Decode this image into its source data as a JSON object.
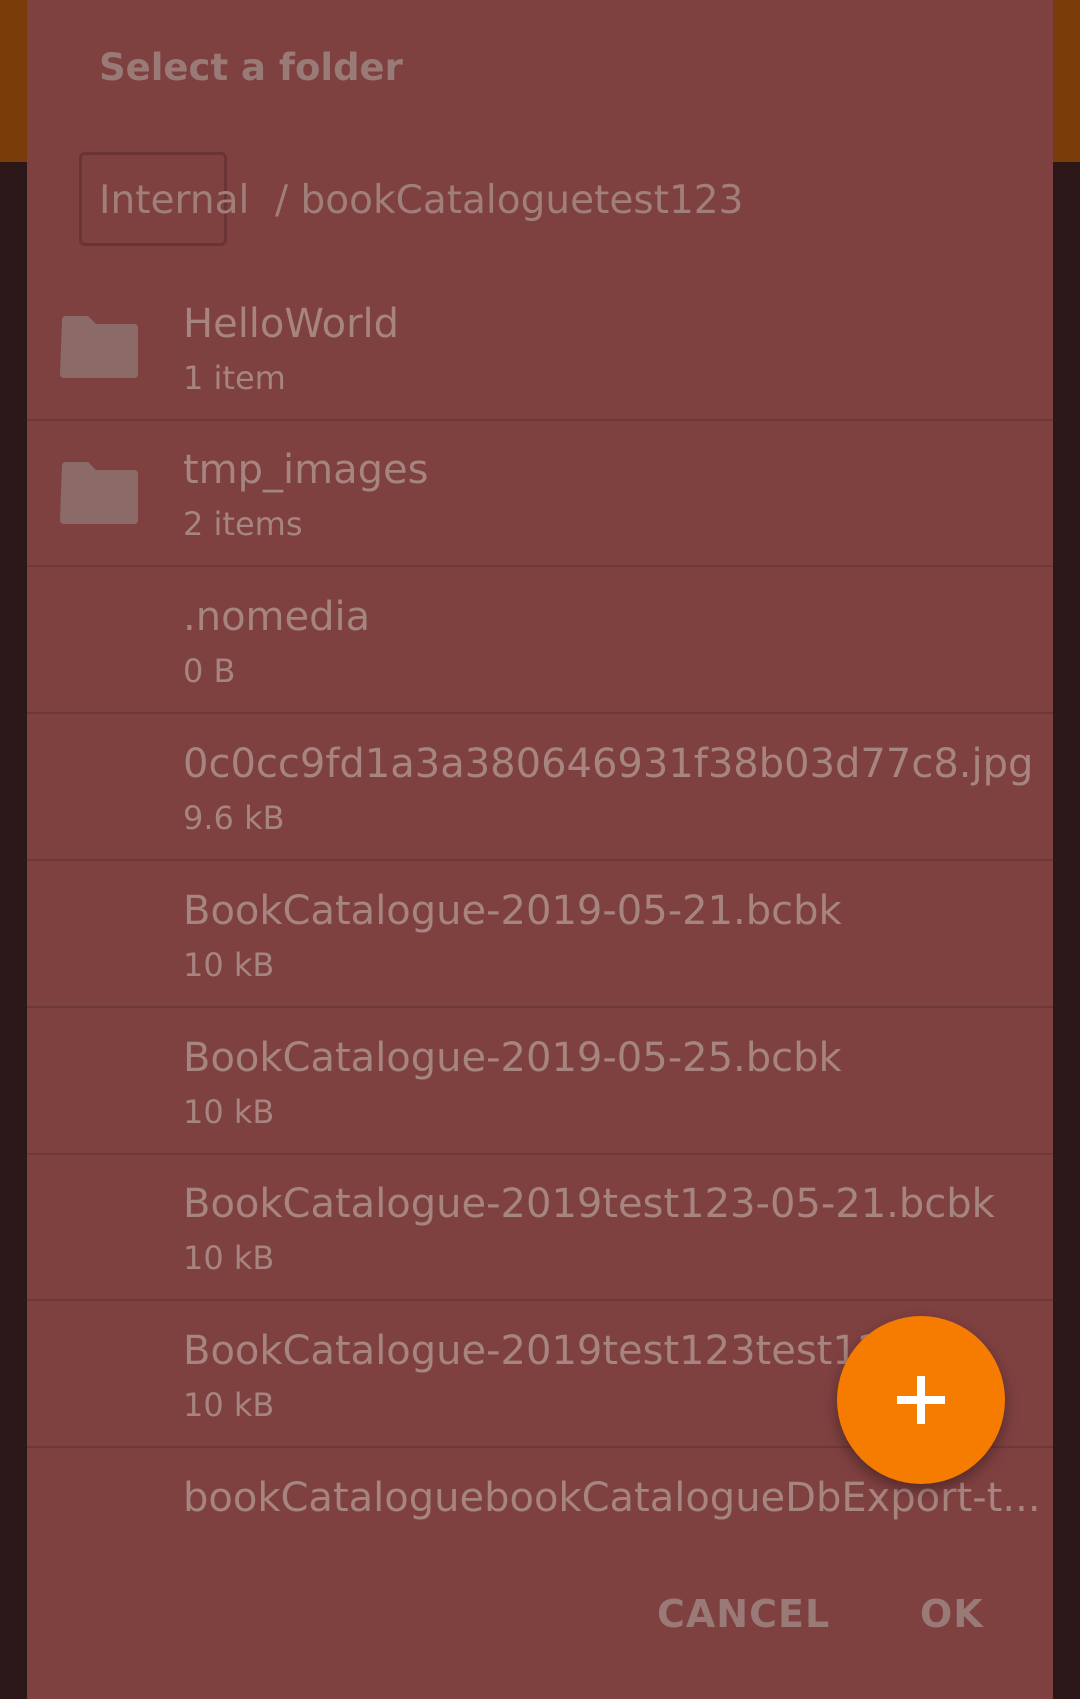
{
  "dialog": {
    "title": "Select a folder",
    "breadcrumb": {
      "root": "Internal",
      "path": "/ bookCataloguetest123"
    },
    "items": [
      {
        "type": "folder",
        "name": "HelloWorld",
        "detail": "1 item"
      },
      {
        "type": "folder",
        "name": "tmp_images",
        "detail": "2 items"
      },
      {
        "type": "file",
        "name": ".nomedia",
        "detail": "0 B"
      },
      {
        "type": "file",
        "name": "0c0cc9fd1a3a380646931f38b03d77c8.jpg",
        "detail": "9.6 kB"
      },
      {
        "type": "file",
        "name": "BookCatalogue-2019-05-21.bcbk",
        "detail": "10 kB"
      },
      {
        "type": "file",
        "name": "BookCatalogue-2019-05-25.bcbk",
        "detail": "10 kB"
      },
      {
        "type": "file",
        "name": "BookCatalogue-2019test123-05-21.bcbk",
        "detail": "10 kB"
      },
      {
        "type": "file",
        "name": "BookCatalogue-2019test123test123",
        "detail": "10 kB"
      },
      {
        "type": "file",
        "name": "bookCataloguebookCatalogueDbExport-t...",
        "detail": ""
      }
    ],
    "buttons": {
      "cancel": "CANCEL",
      "ok": "OK"
    },
    "fab_icon": "plus-icon"
  },
  "colors": {
    "accent": "#f57c00",
    "dialog_bg": "#7f4040",
    "text": "#a6847f"
  }
}
